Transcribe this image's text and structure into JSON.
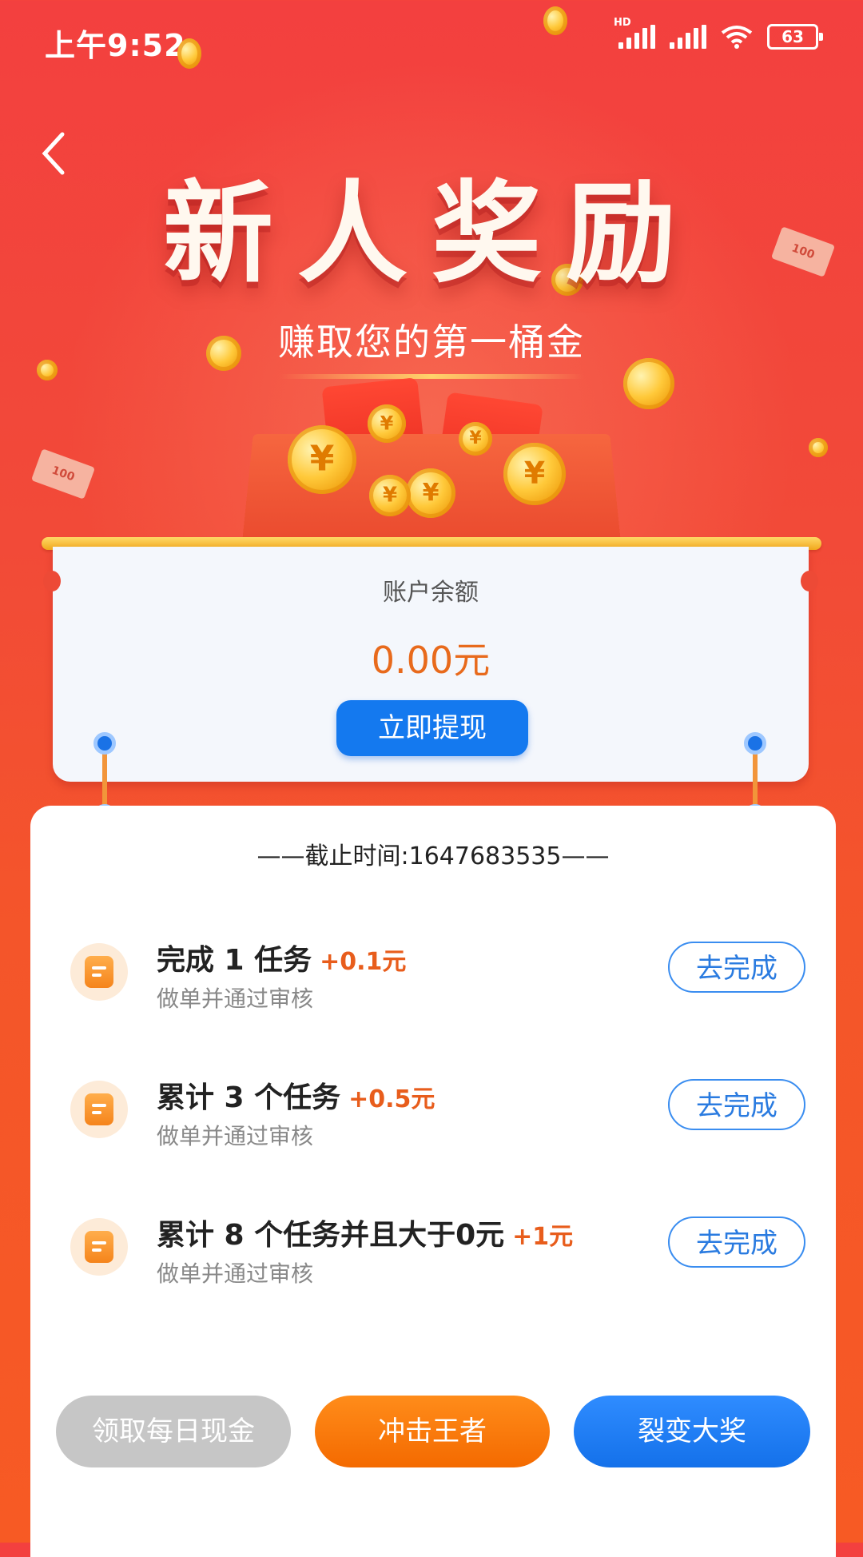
{
  "status_bar": {
    "time": "上午9:52",
    "hd_label": "HD",
    "battery": "63"
  },
  "hero": {
    "title": "新人奖励",
    "subtitle": "赚取您的第一桶金",
    "coin_symbol": "¥",
    "note_label": "100"
  },
  "balance": {
    "label": "账户余额",
    "value": "0.00元",
    "withdraw_label": "立即提现"
  },
  "deadline": "——截止时间:1647683535——",
  "tasks": [
    {
      "title": "完成 1 任务",
      "reward": "+0.1元",
      "desc": "做单并通过审核",
      "action": "去完成"
    },
    {
      "title": "累计 3 个任务",
      "reward": "+0.5元",
      "desc": "做单并通过审核",
      "action": "去完成"
    },
    {
      "title": "累计 8 个任务并且大于0元",
      "reward": "+1元",
      "desc": "做单并通过审核",
      "action": "去完成"
    }
  ],
  "bottom_buttons": {
    "daily_cash": "领取每日现金",
    "king": "冲击王者",
    "fission": "裂变大奖"
  },
  "colors": {
    "background": "#f24a38",
    "accent_orange": "#f46a00",
    "accent_blue": "#1479ef",
    "reward_text": "#e85d1c"
  }
}
